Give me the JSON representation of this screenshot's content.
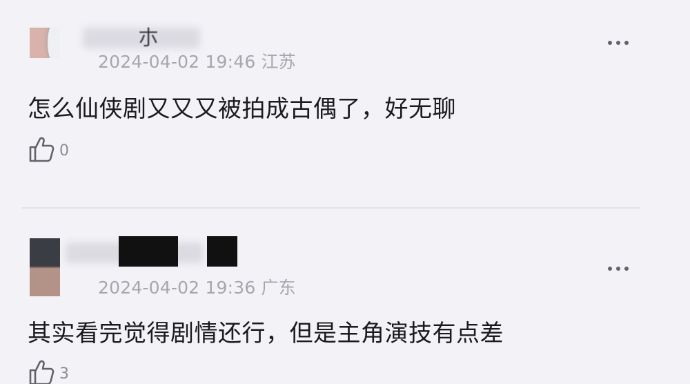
{
  "comments": [
    {
      "name_visible_fragment": "朩",
      "date": "2024-04-02 19:46",
      "location": "江苏",
      "content": "怎么仙侠剧又又又被拍成古偶了，好无聊",
      "like_count": "0"
    },
    {
      "date": "2024-04-02 19:36",
      "location": "广东",
      "content": "其实看完觉得剧情还行，但是主角演技有点差",
      "like_count": "3"
    }
  ],
  "icons": {
    "more": "more-horizontal-icon",
    "like": "thumbs-up-icon"
  },
  "colors": {
    "background": "#f3f2f7",
    "text": "#1b1b1f",
    "meta": "#a6a6ad",
    "divider": "#e2e1e8"
  }
}
